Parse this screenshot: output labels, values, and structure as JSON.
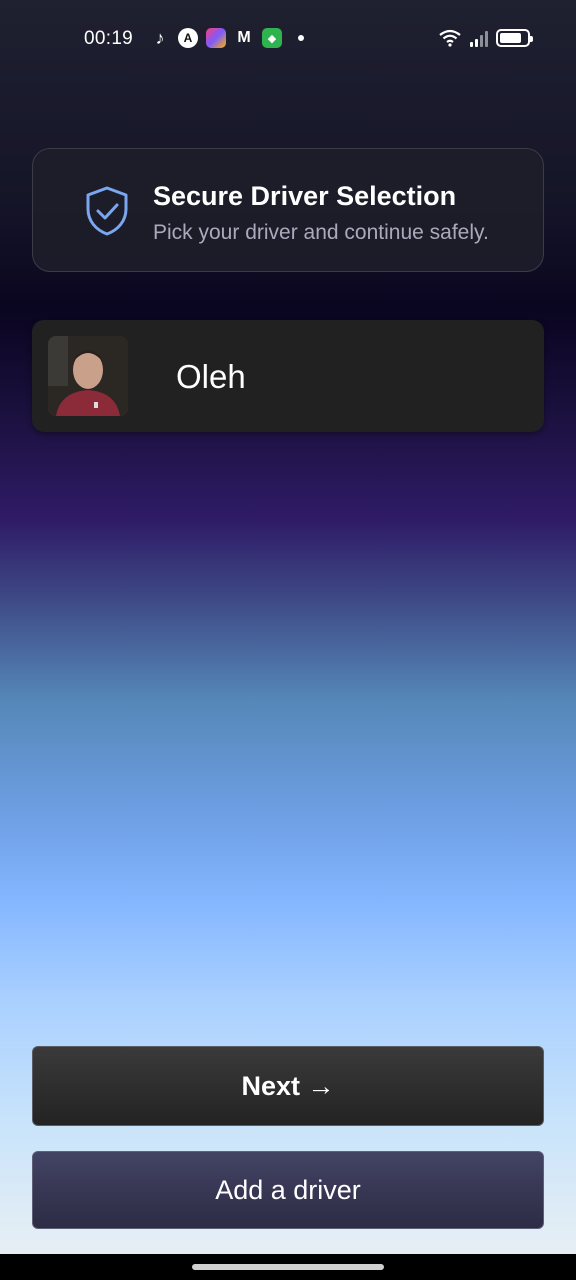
{
  "status_bar": {
    "time": "00:19",
    "notification_icons": [
      "tiktok-icon",
      "app-a-icon",
      "photo-app-icon",
      "gmail-icon",
      "shield-app-icon"
    ],
    "system_icons": [
      "wifi-icon",
      "signal-icon",
      "battery-icon"
    ]
  },
  "secure_card": {
    "title": "Secure Driver Selection",
    "subtitle": "Pick your driver and continue safely.",
    "icon": "shield-check-icon"
  },
  "drivers": [
    {
      "name": "Oleh",
      "avatar": "driver-photo"
    }
  ],
  "actions": {
    "next_label": "Next →",
    "add_label": "Add a driver"
  },
  "colors": {
    "accent_shield": "#7aa8f0",
    "card_bg": "#212121",
    "next_button_bg": "#2e2e2e",
    "add_button_bg": "#383855"
  }
}
